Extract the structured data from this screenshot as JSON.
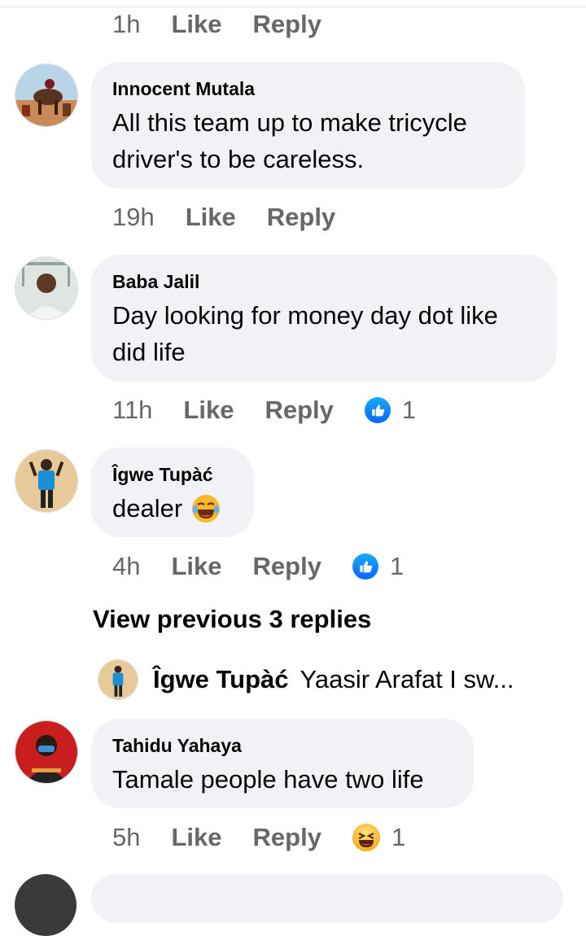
{
  "top_meta": {
    "time": "1h",
    "like": "Like",
    "reply": "Reply"
  },
  "comments": [
    {
      "name": "Innocent Mutala",
      "text": "All this team up to make tricycle driver's to be careless.",
      "time": "19h",
      "like": "Like",
      "reply": "Reply"
    },
    {
      "name": "Baba Jalil",
      "text": "Day looking for money  day dot like did life",
      "time": "11h",
      "like": "Like",
      "reply": "Reply",
      "reaction": {
        "icon": "like-icon",
        "count": "1"
      }
    },
    {
      "name": "Îgwe Tupàć",
      "text": "dealer",
      "time": "4h",
      "like": "Like",
      "reply": "Reply",
      "reaction": {
        "icon": "like-icon",
        "count": "1"
      }
    },
    {
      "name": "Tahidu Yahaya",
      "text": "Tamale people have two life",
      "time": "5h",
      "like": "Like",
      "reply": "Reply",
      "reaction": {
        "icon": "haha-icon",
        "count": "1"
      }
    }
  ],
  "view_previous": "View previous 3 replies",
  "reply_preview": {
    "name": "Îgwe Tupàć",
    "text": "Yaasir Arafat I sw..."
  },
  "colors": {
    "like_blue": "#0866ff",
    "meta_gray": "#65676b",
    "bubble_bg": "#f0f2f5"
  }
}
